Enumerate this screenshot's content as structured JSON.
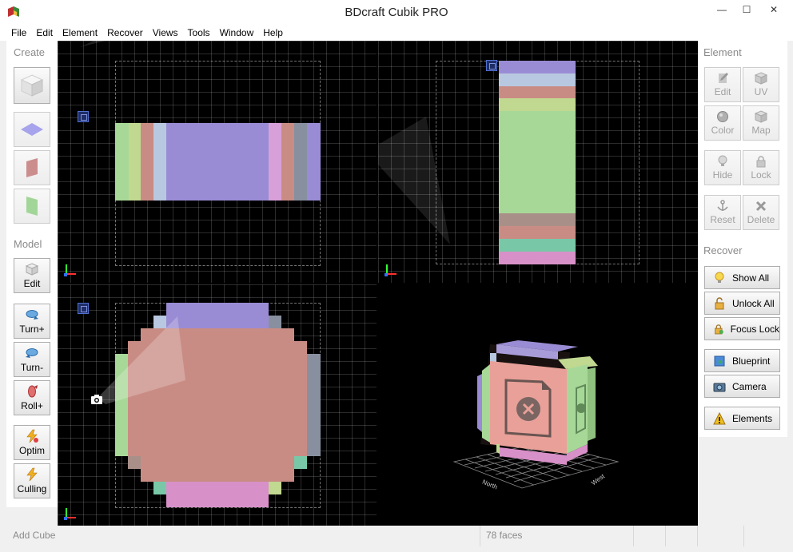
{
  "window": {
    "title": "BDcraft Cubik PRO",
    "controls": {
      "minimize": "—",
      "maximize": "☐",
      "close": "✕"
    }
  },
  "menu": [
    "File",
    "Edit",
    "Element",
    "Recover",
    "Views",
    "Tools",
    "Window",
    "Help"
  ],
  "left_panel": {
    "create_title": "Create",
    "model_title": "Model",
    "model_buttons": [
      {
        "label": "Edit",
        "icon": "cube-edit-icon"
      },
      {
        "label": "Turn+",
        "icon": "turn-right-icon"
      },
      {
        "label": "Turn-",
        "icon": "turn-left-icon"
      },
      {
        "label": "Roll+",
        "icon": "roll-icon"
      },
      {
        "label": "Optim",
        "icon": "lightning-optimize-icon"
      },
      {
        "label": "Culling",
        "icon": "lightning-culling-icon"
      }
    ]
  },
  "right_panel": {
    "element_title": "Element",
    "element_buttons": [
      {
        "label": "Edit",
        "icon": "edit-icon"
      },
      {
        "label": "UV",
        "icon": "uv-icon"
      },
      {
        "label": "Color",
        "icon": "color-icon"
      },
      {
        "label": "Map",
        "icon": "map-icon"
      },
      {
        "label": "Hide",
        "icon": "bulb-icon"
      },
      {
        "label": "Lock",
        "icon": "lock-icon"
      },
      {
        "label": "Reset",
        "icon": "anchor-icon"
      },
      {
        "label": "Delete",
        "icon": "delete-icon"
      }
    ],
    "recover_title": "Recover",
    "recover_buttons": [
      {
        "label": "Show All",
        "icon": "bulb-icon"
      },
      {
        "label": "Unlock All",
        "icon": "unlock-icon"
      },
      {
        "label": "Focus Lock",
        "icon": "focus-lock-icon"
      },
      {
        "label": "Blueprint",
        "icon": "blueprint-icon"
      },
      {
        "label": "Camera",
        "icon": "camera-icon"
      },
      {
        "label": "Elements",
        "icon": "warning-icon"
      }
    ]
  },
  "viewport_3d": {
    "labels": {
      "north": "North",
      "west": "West"
    }
  },
  "status": {
    "left": "Add Cube",
    "faces": "78 faces"
  },
  "colors": {
    "green": "#a8d898",
    "purple": "#9a8cd4",
    "salmon": "#c98c84",
    "lightblue": "#b8c8e0",
    "pink": "#d890c8",
    "teal": "#78c8a8",
    "slate": "#8890a0"
  }
}
